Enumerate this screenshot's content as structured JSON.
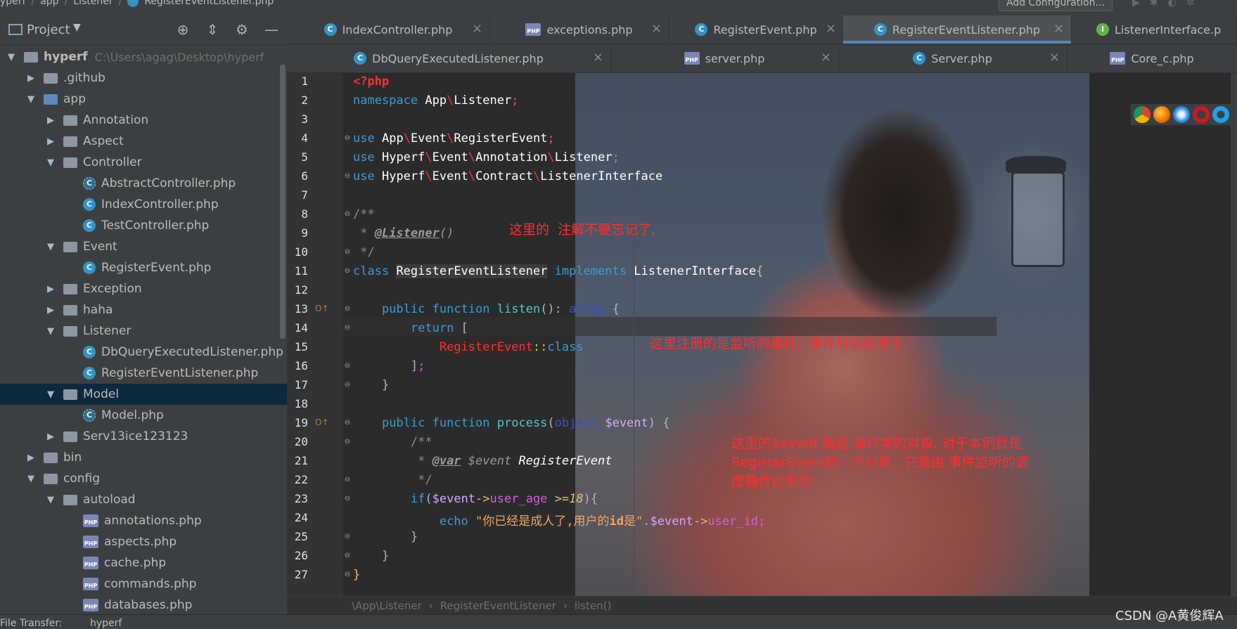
{
  "topbar": {
    "crumbs": [
      "yperf",
      "app",
      "Listener",
      "RegisterEventListener.php"
    ],
    "add_configuration": "Add Configuration..."
  },
  "sidebar": {
    "title": "Project",
    "tree": [
      {
        "label": "hyperf",
        "path": "C:\\Users\\agag\\Desktop\\hyperf",
        "type": "folder",
        "depth": 0,
        "expanded": true
      },
      {
        "label": ".github",
        "type": "folder",
        "depth": 1,
        "expanded": false
      },
      {
        "label": "app",
        "type": "folder-blue",
        "depth": 1,
        "expanded": true
      },
      {
        "label": "Annotation",
        "type": "folder",
        "depth": 2,
        "expanded": false
      },
      {
        "label": "Aspect",
        "type": "folder",
        "depth": 2,
        "expanded": false
      },
      {
        "label": "Controller",
        "type": "folder",
        "depth": 2,
        "expanded": true
      },
      {
        "label": "AbstractController.php",
        "type": "class-abstract",
        "depth": 3
      },
      {
        "label": "IndexController.php",
        "type": "class",
        "depth": 3
      },
      {
        "label": "TestController.php",
        "type": "class",
        "depth": 3
      },
      {
        "label": "Event",
        "type": "folder",
        "depth": 2,
        "expanded": true
      },
      {
        "label": "RegisterEvent.php",
        "type": "class",
        "depth": 3
      },
      {
        "label": "Exception",
        "type": "folder",
        "depth": 2,
        "expanded": false
      },
      {
        "label": "haha",
        "type": "folder",
        "depth": 2,
        "expanded": false
      },
      {
        "label": "Listener",
        "type": "folder",
        "depth": 2,
        "expanded": true
      },
      {
        "label": "DbQueryExecutedListener.php",
        "type": "class",
        "depth": 3
      },
      {
        "label": "RegisterEventListener.php",
        "type": "class",
        "depth": 3
      },
      {
        "label": "Model",
        "type": "folder",
        "depth": 2,
        "expanded": true,
        "selected": true
      },
      {
        "label": "Model.php",
        "type": "class-abstract",
        "depth": 3
      },
      {
        "label": "Serv13ice123123",
        "type": "folder",
        "depth": 2,
        "expanded": false
      },
      {
        "label": "bin",
        "type": "folder",
        "depth": 1,
        "expanded": false
      },
      {
        "label": "config",
        "type": "folder",
        "depth": 1,
        "expanded": true
      },
      {
        "label": "autoload",
        "type": "folder",
        "depth": 2,
        "expanded": true
      },
      {
        "label": "annotations.php",
        "type": "php",
        "depth": 3
      },
      {
        "label": "aspects.php",
        "type": "php",
        "depth": 3
      },
      {
        "label": "cache.php",
        "type": "php",
        "depth": 3
      },
      {
        "label": "commands.php",
        "type": "php",
        "depth": 3
      },
      {
        "label": "databases.php",
        "type": "php",
        "depth": 3
      }
    ]
  },
  "tabs_row1": [
    {
      "label": "IndexController.php",
      "icon": "class",
      "active": false
    },
    {
      "label": "exceptions.php",
      "icon": "php",
      "active": false
    },
    {
      "label": "RegisterEvent.php",
      "icon": "class",
      "active": false
    },
    {
      "label": "RegisterEventListener.php",
      "icon": "class",
      "active": true
    },
    {
      "label": "ListenerInterface.p",
      "icon": "interface",
      "active": false
    }
  ],
  "tabs_row2": [
    {
      "label": "DbQueryExecutedListener.php",
      "icon": "class"
    },
    {
      "label": "server.php",
      "icon": "php"
    },
    {
      "label": "Server.php",
      "icon": "class"
    },
    {
      "label": "Core_c.php",
      "icon": "php"
    }
  ],
  "code": {
    "line_numbers": [
      "1",
      "2",
      "3",
      "4",
      "5",
      "6",
      "7",
      "8",
      "9",
      "10",
      "11",
      "12",
      "13",
      "14",
      "15",
      "16",
      "17",
      "18",
      "19",
      "20",
      "21",
      "22",
      "23",
      "24",
      "25",
      "26",
      "27"
    ],
    "annotations": {
      "a1": "这里的  注解不要忘记了,",
      "a2": "这里注册的是监听的事件,  事件可以有多个",
      "a3": "这里的$event 就是 事件类的对象, 对于本例就是\nRegisterEvent的一个对象,  它是由 事件监听的调\n度器传过来的"
    }
  },
  "breadcrumb": [
    "\\App\\Listener",
    "RegisterEventListener",
    "listen()"
  ],
  "statusbar": {
    "left": "File Transfer:",
    "value": "hyperf"
  },
  "watermark": "CSDN @A黄俊辉A",
  "colors": {
    "accent": "#4a88c7",
    "selection": "#0d293e",
    "annotation": "#ff2d2d"
  }
}
